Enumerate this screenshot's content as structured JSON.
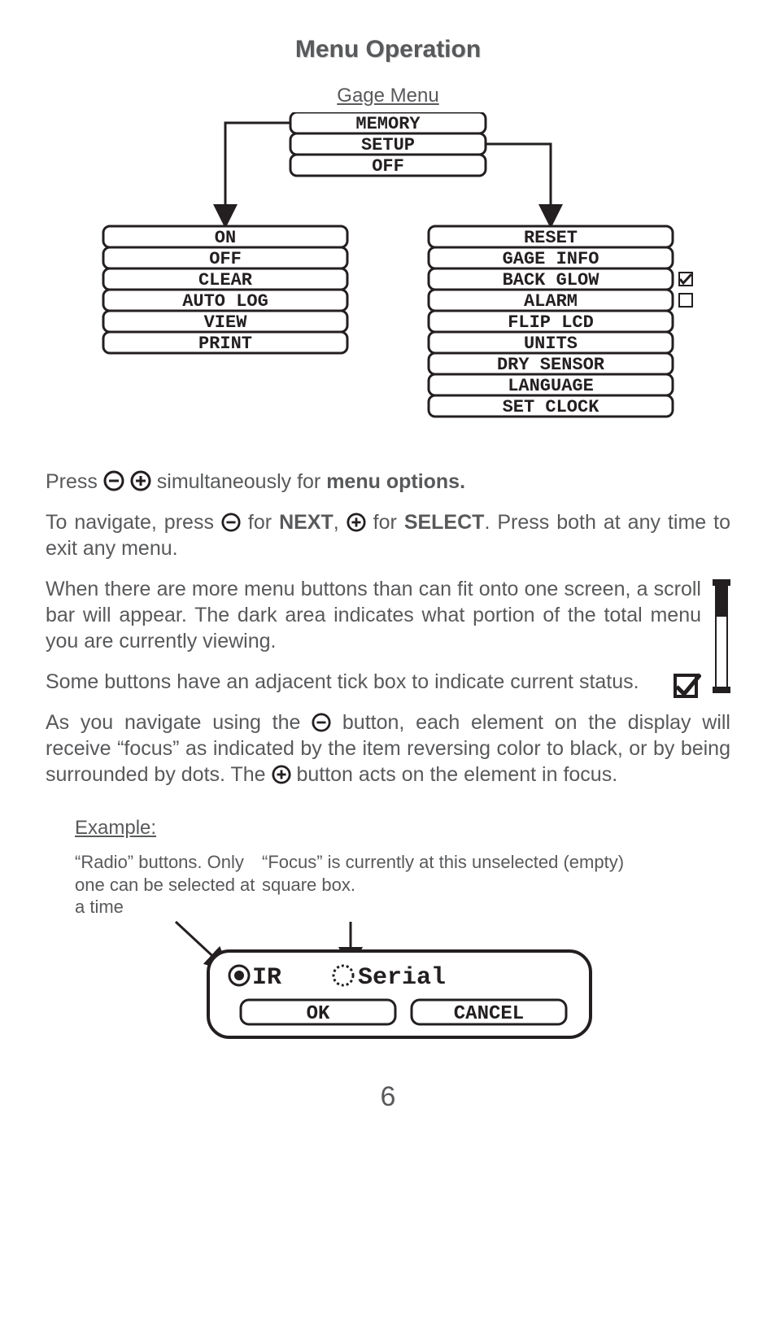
{
  "title": "Menu Operation",
  "diagram_caption": "Gage Menu",
  "menu": {
    "top": [
      "MEMORY",
      "SETUP",
      "OFF"
    ],
    "left": [
      "ON",
      "OFF",
      "CLEAR",
      "AUTO LOG",
      "VIEW",
      "PRINT"
    ],
    "right": [
      "RESET",
      "GAGE INFO",
      "BACK GLOW",
      "ALARM",
      "FLIP LCD",
      "UNITS",
      "DRY SENSOR",
      "LANGUAGE",
      "SET CLOCK"
    ],
    "right_checkboxes": {
      "BACK GLOW": true,
      "ALARM": false
    }
  },
  "para1_pre": "Press ",
  "para1_post": " simultaneously for ",
  "para1_bold": "menu options.",
  "para2_a": "To navigate, press ",
  "para2_b": " for ",
  "para2_next": "NEXT",
  "para2_c": ", ",
  "para2_d": " for ",
  "para2_select": "SELECT",
  "para2_e": ". Press both at any time to exit any menu.",
  "para3": "When there are more menu buttons than can fit onto one screen, a scroll bar will appear. The dark area indicates what portion of the total menu you are currently viewing.",
  "para4": "Some buttons have an adjacent tick box to indicate current status.",
  "para5_a": "As you navigate using the ",
  "para5_b": " button, each element on the display will receive “focus” as indicated by the item reversing color to black, or by being surrounded by dots.  The ",
  "para5_c": " button acts on the element in focus.",
  "example_heading": "Example:",
  "example_left": "“Radio” buttons. Only one can be selected at a time",
  "example_right": "“Focus” is currently at this unselected (empty) square box.",
  "example_device": {
    "opt1": "IR",
    "opt2": "Serial",
    "ok": "OK",
    "cancel": "CANCEL"
  },
  "page_number": "6"
}
